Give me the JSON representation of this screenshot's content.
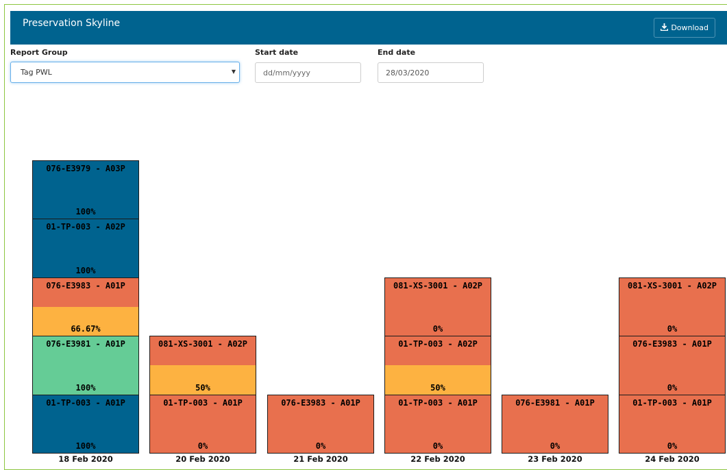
{
  "header": {
    "title": "Preservation Skyline",
    "download_label": "Download"
  },
  "filters": {
    "report_group_label": "Report Group",
    "report_group_value": "Tag PWL",
    "start_date_label": "Start date",
    "start_date_placeholder": "dd/mm/yyyy",
    "end_date_label": "End date",
    "end_date_value": "28/03/2020"
  },
  "colors": {
    "header_bg": "#00638f",
    "blue": "#00638f",
    "red": "#e8704e",
    "orange": "#fdb241",
    "green": "#65cc96",
    "frame": "#8cc63f"
  },
  "chart_data": {
    "type": "bar",
    "stacked": true,
    "categories": [
      "18 Feb 2020",
      "20 Feb 2020",
      "21 Feb 2020",
      "22 Feb 2020",
      "23 Feb 2020",
      "24 Feb 2020"
    ],
    "columns": [
      {
        "date": "18 Feb 2020",
        "segments": [
          {
            "name": "076-E3979 - A03P",
            "percent": "100%",
            "status": "blue"
          },
          {
            "name": "01-TP-003 - A02P",
            "percent": "100%",
            "status": "blue"
          },
          {
            "name": "076-E3983 - A01P",
            "percent": "66.67%",
            "status": "orange"
          },
          {
            "name": "076-E3981 - A01P",
            "percent": "100%",
            "status": "green"
          },
          {
            "name": "01-TP-003 - A01P",
            "percent": "100%",
            "status": "blue"
          }
        ]
      },
      {
        "date": "20 Feb 2020",
        "segments": [
          {
            "name": "081-XS-3001 - A02P",
            "percent": "50%",
            "status": "orange"
          },
          {
            "name": "01-TP-003 - A01P",
            "percent": "0%",
            "status": "red"
          }
        ]
      },
      {
        "date": "21 Feb 2020",
        "segments": [
          {
            "name": "076-E3983 - A01P",
            "percent": "0%",
            "status": "red"
          }
        ]
      },
      {
        "date": "22 Feb 2020",
        "segments": [
          {
            "name": "081-XS-3001 - A02P",
            "percent": "0%",
            "status": "red"
          },
          {
            "name": "01-TP-003 - A02P",
            "percent": "50%",
            "status": "orange"
          },
          {
            "name": "01-TP-003 - A01P",
            "percent": "0%",
            "status": "red"
          }
        ]
      },
      {
        "date": "23 Feb 2020",
        "segments": [
          {
            "name": "076-E3981 - A01P",
            "percent": "0%",
            "status": "red"
          }
        ]
      },
      {
        "date": "24 Feb 2020",
        "segments": [
          {
            "name": "081-XS-3001 - A02P",
            "percent": "0%",
            "status": "red"
          },
          {
            "name": "076-E3983 - A01P",
            "percent": "0%",
            "status": "red"
          },
          {
            "name": "01-TP-003 - A01P",
            "percent": "0%",
            "status": "red"
          }
        ]
      }
    ]
  }
}
